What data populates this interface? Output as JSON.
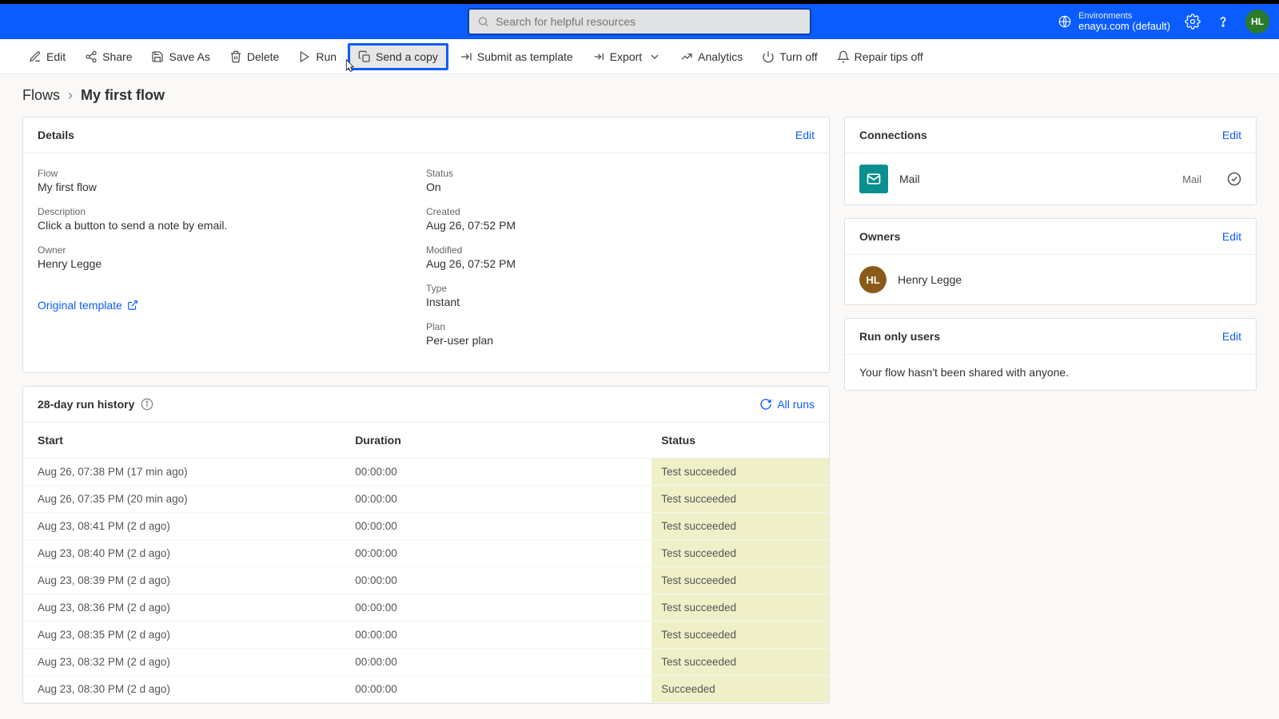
{
  "header": {
    "search_placeholder": "Search for helpful resources",
    "env_label": "Environments",
    "env_name": "enayu.com (default)",
    "avatar": "HL"
  },
  "cmdbar": {
    "edit": "Edit",
    "share": "Share",
    "saveas": "Save As",
    "delete": "Delete",
    "run": "Run",
    "sendcopy": "Send a copy",
    "submit": "Submit as template",
    "export": "Export",
    "analytics": "Analytics",
    "turnoff": "Turn off",
    "repair": "Repair tips off"
  },
  "breadcrumb": {
    "root": "Flows",
    "leaf": "My first flow"
  },
  "details": {
    "title": "Details",
    "edit": "Edit",
    "flow_label": "Flow",
    "flow_val": "My first flow",
    "desc_label": "Description",
    "desc_val": "Click a button to send a note by email.",
    "owner_label": "Owner",
    "owner_val": "Henry Legge",
    "status_label": "Status",
    "status_val": "On",
    "created_label": "Created",
    "created_val": "Aug 26, 07:52 PM",
    "modified_label": "Modified",
    "modified_val": "Aug 26, 07:52 PM",
    "type_label": "Type",
    "type_val": "Instant",
    "plan_label": "Plan",
    "plan_val": "Per-user plan",
    "orig_template": "Original template"
  },
  "connections": {
    "title": "Connections",
    "edit": "Edit",
    "name": "Mail",
    "type": "Mail"
  },
  "owners": {
    "title": "Owners",
    "edit": "Edit",
    "initials": "HL",
    "name": "Henry Legge"
  },
  "runonly": {
    "title": "Run only users",
    "edit": "Edit",
    "empty": "Your flow hasn't been shared with anyone."
  },
  "runs": {
    "title": "28-day run history",
    "all_runs": "All runs",
    "cols": {
      "start": "Start",
      "duration": "Duration",
      "status": "Status"
    },
    "rows": [
      {
        "start": "Aug 26, 07:38 PM (17 min ago)",
        "duration": "00:00:00",
        "status": "Test succeeded"
      },
      {
        "start": "Aug 26, 07:35 PM (20 min ago)",
        "duration": "00:00:00",
        "status": "Test succeeded"
      },
      {
        "start": "Aug 23, 08:41 PM (2 d ago)",
        "duration": "00:00:00",
        "status": "Test succeeded"
      },
      {
        "start": "Aug 23, 08:40 PM (2 d ago)",
        "duration": "00:00:00",
        "status": "Test succeeded"
      },
      {
        "start": "Aug 23, 08:39 PM (2 d ago)",
        "duration": "00:00:00",
        "status": "Test succeeded"
      },
      {
        "start": "Aug 23, 08:36 PM (2 d ago)",
        "duration": "00:00:00",
        "status": "Test succeeded"
      },
      {
        "start": "Aug 23, 08:35 PM (2 d ago)",
        "duration": "00:00:00",
        "status": "Test succeeded"
      },
      {
        "start": "Aug 23, 08:32 PM (2 d ago)",
        "duration": "00:00:00",
        "status": "Test succeeded"
      },
      {
        "start": "Aug 23, 08:30 PM (2 d ago)",
        "duration": "00:00:00",
        "status": "Succeeded"
      }
    ]
  }
}
